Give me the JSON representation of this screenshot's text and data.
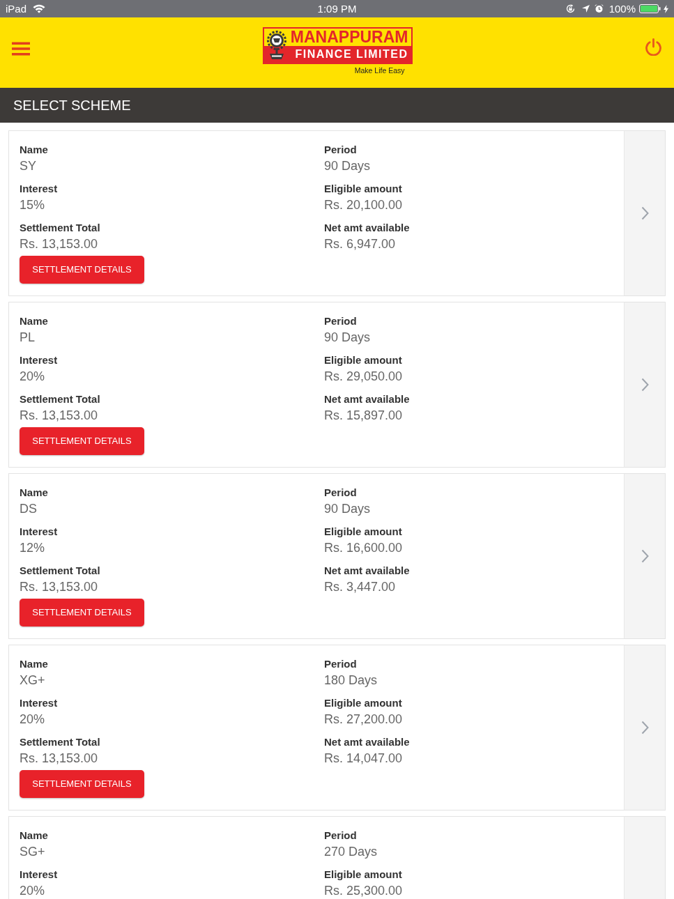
{
  "status_bar": {
    "device": "iPad",
    "time": "1:09 PM",
    "battery": "100%"
  },
  "header": {
    "logo": {
      "wordmark": "MANAPPURAM",
      "subtitle": "FINANCE LIMITED",
      "tagline": "Make Life Easy"
    }
  },
  "page_title": "SELECT SCHEME",
  "schemes": [
    {
      "left": [
        {
          "label": "Name",
          "value": "SY"
        },
        {
          "label": "Interest",
          "value": "15%"
        },
        {
          "label": "Settlement Total",
          "value": "Rs. 13,153.00"
        }
      ],
      "right": [
        {
          "label": "Period",
          "value": "90 Days"
        },
        {
          "label": "Eligible amount",
          "value": "Rs. 20,100.00"
        },
        {
          "label": "Net amt available",
          "value": "Rs. 6,947.00"
        }
      ],
      "button": "SETTLEMENT DETAILS",
      "open_arrow": true
    },
    {
      "left": [
        {
          "label": "Name",
          "value": "PL"
        },
        {
          "label": "Interest",
          "value": "20%"
        },
        {
          "label": "Settlement Total",
          "value": "Rs. 13,153.00"
        }
      ],
      "right": [
        {
          "label": "Period",
          "value": "90 Days"
        },
        {
          "label": "Eligible amount",
          "value": "Rs. 29,050.00"
        },
        {
          "label": "Net amt available",
          "value": "Rs. 15,897.00"
        }
      ],
      "button": "SETTLEMENT DETAILS",
      "open_arrow": true
    },
    {
      "left": [
        {
          "label": "Name",
          "value": "DS"
        },
        {
          "label": "Interest",
          "value": "12%"
        },
        {
          "label": "Settlement Total",
          "value": "Rs. 13,153.00"
        }
      ],
      "right": [
        {
          "label": "Period",
          "value": "90 Days"
        },
        {
          "label": "Eligible amount",
          "value": "Rs. 16,600.00"
        },
        {
          "label": "Net amt available",
          "value": "Rs. 3,447.00"
        }
      ],
      "button": "SETTLEMENT DETAILS",
      "open_arrow": true
    },
    {
      "left": [
        {
          "label": "Name",
          "value": "XG+"
        },
        {
          "label": "Interest",
          "value": "20%"
        },
        {
          "label": "Settlement Total",
          "value": "Rs. 13,153.00"
        }
      ],
      "right": [
        {
          "label": "Period",
          "value": "180 Days"
        },
        {
          "label": "Eligible amount",
          "value": "Rs. 27,200.00"
        },
        {
          "label": "Net amt available",
          "value": "Rs. 14,047.00"
        }
      ],
      "button": "SETTLEMENT DETAILS",
      "open_arrow": true
    },
    {
      "left": [
        {
          "label": "Name",
          "value": "SG+"
        },
        {
          "label": "Interest",
          "value": "20%"
        }
      ],
      "right": [
        {
          "label": "Period",
          "value": "270 Days"
        },
        {
          "label": "Eligible amount",
          "value": "Rs. 25,300.00"
        }
      ],
      "open_arrow": false
    }
  ]
}
